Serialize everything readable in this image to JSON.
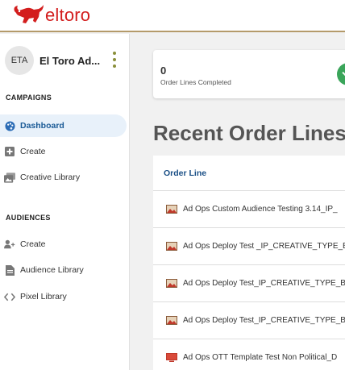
{
  "brand": {
    "name": "eltoro",
    "color": "#d31e1e"
  },
  "account": {
    "initials": "ETA",
    "name": "El Toro Ad..."
  },
  "sidebar": {
    "campaigns_title": "CAMPAIGNS",
    "campaigns": [
      {
        "label": "Dashboard",
        "icon": "palette-icon",
        "active": true
      },
      {
        "label": "Create",
        "icon": "plus-square-icon"
      },
      {
        "label": "Creative Library",
        "icon": "images-icon"
      }
    ],
    "audiences_title": "AUDIENCES",
    "audiences": [
      {
        "label": "Create",
        "icon": "user-plus-icon"
      },
      {
        "label": "Audience Library",
        "icon": "file-icon"
      },
      {
        "label": "Pixel Library",
        "icon": "code-icon"
      }
    ]
  },
  "stat_card": {
    "value": "0",
    "label": "Order Lines Completed"
  },
  "main": {
    "title": "Recent Order Lines",
    "table": {
      "header": "Order Line",
      "rows": [
        {
          "name": "Ad Ops Custom Audience Testing 3.14_IP_",
          "icon": "image-icon"
        },
        {
          "name": "Ad Ops Deploy Test _IP_CREATIVE_TYPE_B",
          "icon": "image-icon"
        },
        {
          "name": "Ad Ops Deploy Test_IP_CREATIVE_TYPE_B",
          "icon": "image-icon"
        },
        {
          "name": "Ad Ops Deploy Test_IP_CREATIVE_TYPE_B",
          "icon": "image-icon"
        },
        {
          "name": "Ad Ops OTT Template Test Non Political_D",
          "icon": "tv-icon"
        }
      ]
    }
  }
}
